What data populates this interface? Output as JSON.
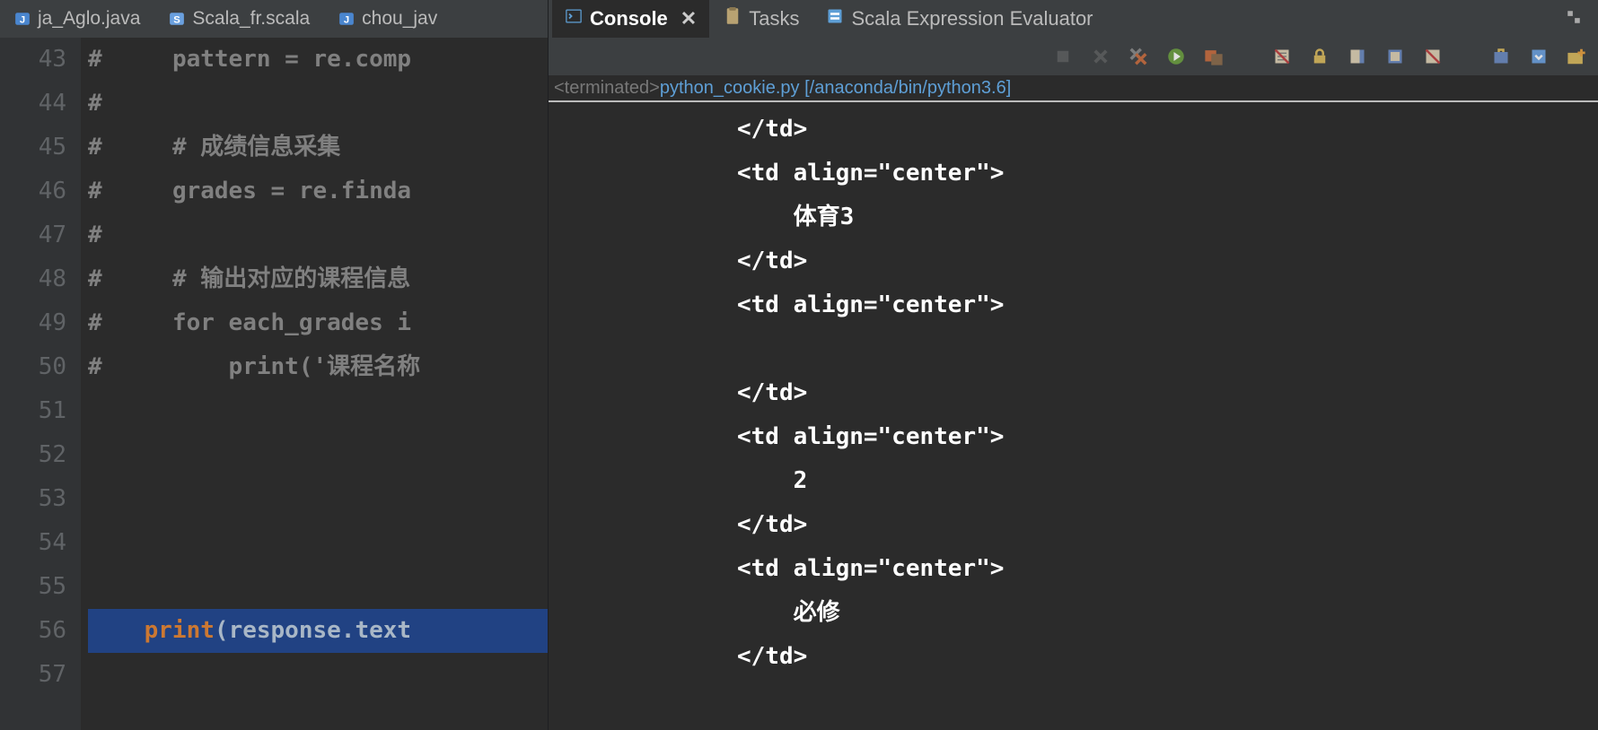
{
  "editorTabs": [
    {
      "label": "ja_Aglo.java",
      "iconType": "java"
    },
    {
      "label": "Scala_fr.scala",
      "iconType": "scala"
    },
    {
      "label": "chou_jav",
      "iconType": "java"
    }
  ],
  "gutter": [
    "43",
    "44",
    "45",
    "46",
    "47",
    "48",
    "49",
    "50",
    "51",
    "52",
    "53",
    "54",
    "55",
    "56",
    "57"
  ],
  "code": {
    "l43_pre": "# ",
    "l43": "pattern = re.comp",
    "l44": "# ",
    "l45_pre": "# ",
    "l45_cmt": "# 成绩信息采集",
    "l46_pre": "# ",
    "l46": "grades = re.finda",
    "l47": "# ",
    "l48_pre": "# ",
    "l48_cmt": "# 输出对应的课程信息",
    "l49_pre": "# ",
    "l49": "for each_grades i",
    "l50_pre": "# ",
    "l50": "print('课程名称",
    "l56_print": "print",
    "l56_paren": "(",
    "l56_ident": "response",
    "l56_dot": ".",
    "l56_attr": "text"
  },
  "consoleTabs": [
    {
      "label": "Console",
      "active": true,
      "closable": true,
      "icon": "console"
    },
    {
      "label": "Tasks",
      "active": false,
      "closable": false,
      "icon": "tasks"
    },
    {
      "label": "Scala Expression Evaluator",
      "active": false,
      "closable": false,
      "icon": "scala-eval"
    }
  ],
  "consoleStatus": {
    "terminated": "<terminated> ",
    "link": "python_cookie.py [/anaconda/bin/python3.6]"
  },
  "consoleOutput": [
    "</td>",
    "<td align=\"center\">",
    "    体育3",
    "</td>",
    "<td align=\"center\">",
    "",
    "</td>",
    "<td align=\"center\">",
    "    2",
    "</td>",
    "<td align=\"center\">",
    "    必修",
    "</td>"
  ],
  "toolbar": {
    "icons": [
      "stop",
      "remove-launch",
      "remove-all",
      "run",
      "debug",
      "clear",
      "scroll-lock",
      "pin",
      "word-wrap",
      "show-console",
      "open",
      "min",
      "max"
    ]
  }
}
